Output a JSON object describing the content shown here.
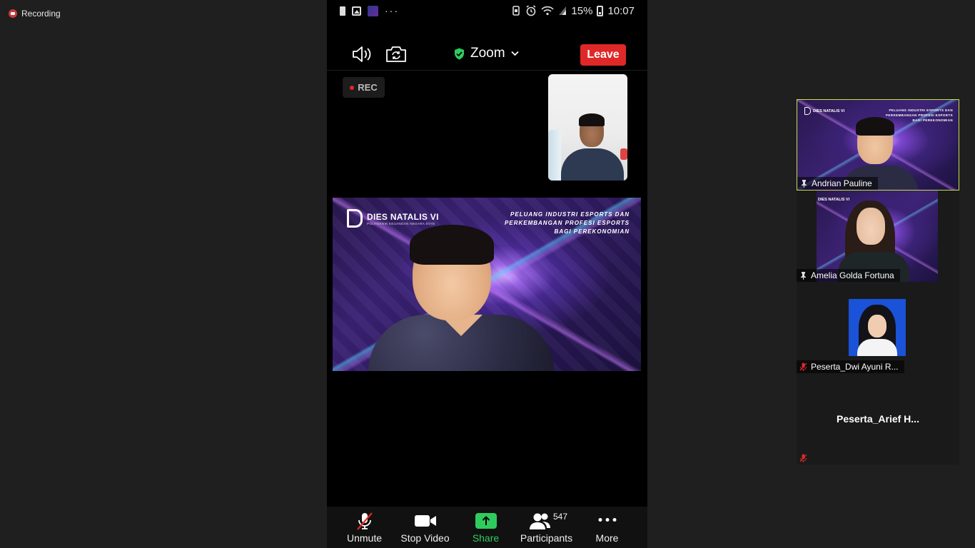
{
  "recording": {
    "label": "Recording"
  },
  "phone": {
    "status_bar": {
      "battery_percent": "15%",
      "time": "10:07",
      "more": "···"
    },
    "toolbar": {
      "meeting_title": "Zoom",
      "leave_label": "Leave"
    },
    "rec_badge": "REC",
    "main_video": {
      "logo_title": "DIES NATALIS VI",
      "logo_subtitle": "POLITEKNIK KEUANGAN NEGARA STAN",
      "caption_lines": [
        "PELUANG INDUSTRI ESPORTS DAN",
        "PERKEMBANGAN PROFESI ESPORTS",
        "BAGI PEREKONOMIAN"
      ]
    },
    "bottom_bar": {
      "unmute_label": "Unmute",
      "stop_video_label": "Stop Video",
      "share_label": "Share",
      "participants_label": "Participants",
      "participants_count": "547",
      "more_label": "More"
    }
  },
  "gallery": {
    "tiles": [
      {
        "name": "Andrian Pauline"
      },
      {
        "name": "Amelia Golda Fortuna"
      },
      {
        "name": "Peserta_Dwi Ayuni R..."
      },
      {
        "name": "Peserta_Arief  H..."
      }
    ]
  },
  "colors": {
    "leave": "#e02828",
    "share": "#2ecc5e",
    "active_speaker_border": "#c7e04a",
    "background": "#1f1f1f"
  }
}
